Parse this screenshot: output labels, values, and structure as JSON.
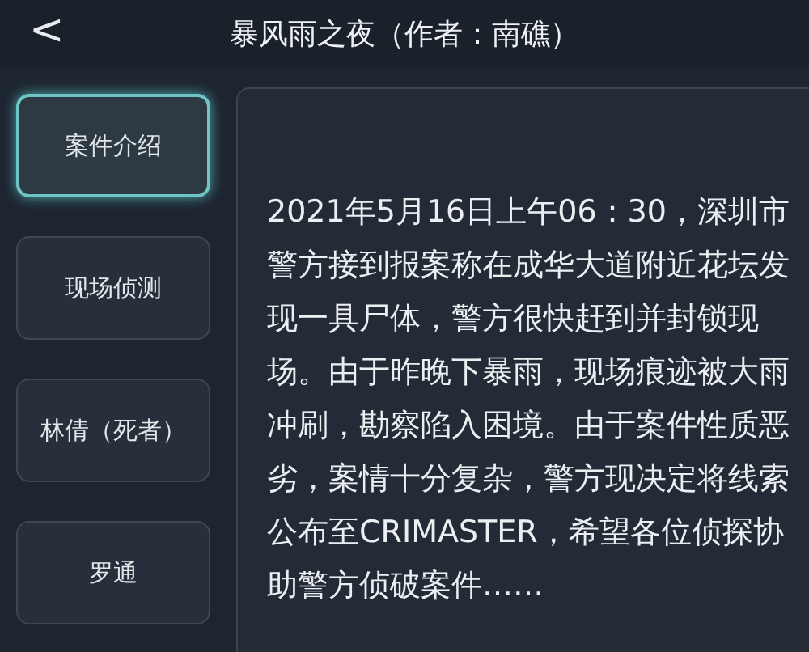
{
  "header": {
    "back": "<",
    "title": "暴风雨之夜（作者：南礁）"
  },
  "sidebar": {
    "items": [
      {
        "label": "案件介绍",
        "selected": true
      },
      {
        "label": "现场侦测",
        "selected": false
      },
      {
        "label": "林倩（死者）",
        "selected": false
      },
      {
        "label": "罗通",
        "selected": false
      }
    ]
  },
  "content": {
    "text": "2021年5月16日上午06：30，深圳市警方接到报案称在成华大道附近花坛发现一具尸体，警方很快赶到并封锁现场。由于昨晚下暴雨，现场痕迹被大雨冲刷，勘察陷入困境。由于案件性质恶劣，案情十分复杂，警方现决定将线索公布至CRIMASTER，希望各位侦探协助警方侦破案件……"
  }
}
